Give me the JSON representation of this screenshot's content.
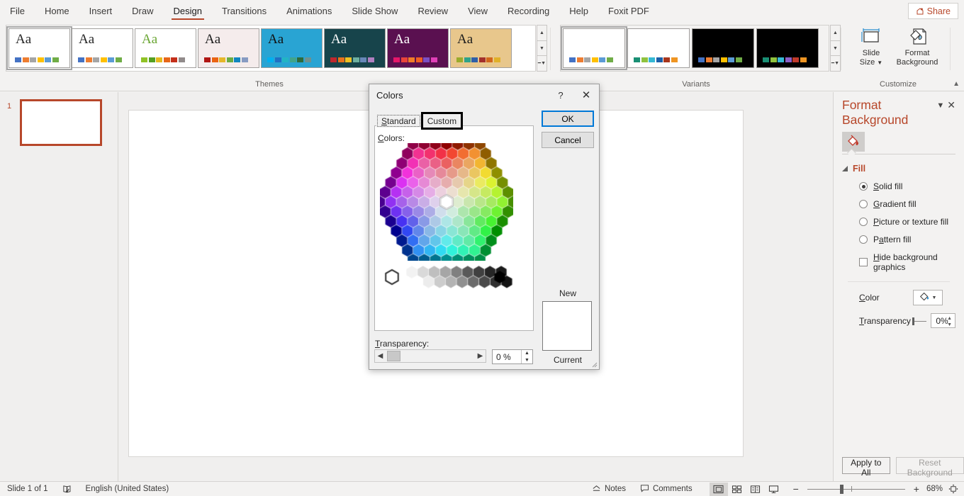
{
  "ribbon": {
    "tabs": [
      {
        "label": "File",
        "active": false
      },
      {
        "label": "Home",
        "active": false
      },
      {
        "label": "Insert",
        "active": false
      },
      {
        "label": "Draw",
        "active": false
      },
      {
        "label": "Design",
        "active": true
      },
      {
        "label": "Transitions",
        "active": false
      },
      {
        "label": "Animations",
        "active": false
      },
      {
        "label": "Slide Show",
        "active": false
      },
      {
        "label": "Review",
        "active": false
      },
      {
        "label": "View",
        "active": false
      },
      {
        "label": "Recording",
        "active": false
      },
      {
        "label": "Help",
        "active": false
      },
      {
        "label": "Foxit PDF",
        "active": false
      }
    ],
    "share_label": "Share",
    "share_icon": "share-person-icon",
    "collapse_icon": "chevron-up-icon",
    "groups": {
      "themes_label": "Themes",
      "variants_label": "Variants",
      "customize_label": "Customize"
    },
    "themes": [
      {
        "name": "office-theme",
        "sample": "Aa",
        "selected": true,
        "bg": "#ffffff",
        "aa_color": "#262626",
        "swatches": [
          "#4472c4",
          "#ed7d31",
          "#a5a5a5",
          "#ffc000",
          "#5b9bd5",
          "#70ad47"
        ]
      },
      {
        "name": "office-theme-2",
        "sample": "Aa",
        "selected": false,
        "bg": "#ffffff",
        "aa_color": "#262626",
        "swatches": [
          "#4472c4",
          "#ed7d31",
          "#a5a5a5",
          "#ffc000",
          "#5b9bd5",
          "#70ad47"
        ]
      },
      {
        "name": "facet-theme",
        "sample": "Aa",
        "selected": false,
        "bg": "#ffffff",
        "aa_color": "#6aa633",
        "swatches": [
          "#90c226",
          "#54a021",
          "#e6b91e",
          "#e76618",
          "#c42f1a",
          "#918b8b"
        ]
      },
      {
        "name": "badge-theme",
        "sample": "Aa",
        "selected": false,
        "bg": "#f5ecec",
        "aa_color": "#1c1c1c",
        "swatches": [
          "#b01513",
          "#ea6312",
          "#e6b729",
          "#6bac43",
          "#1086bf",
          "#879bc2"
        ]
      },
      {
        "name": "ion-boardroom-theme",
        "sample": "Aa",
        "selected": false,
        "bg": "#29a4d3",
        "aa_color": "#111111",
        "swatches": [
          "#00b0f0",
          "#1f6fc4",
          "#22b4c4",
          "#40a48a",
          "#2e6b3b",
          "#6d9191"
        ]
      },
      {
        "name": "wisp-theme",
        "sample": "Aa",
        "selected": false,
        "bg": "#17444b",
        "aa_color": "#ffffff",
        "swatches": [
          "#c0272d",
          "#e8711a",
          "#f0c020",
          "#6eb0a0",
          "#6888b8",
          "#b07fc0"
        ]
      },
      {
        "name": "berlin-theme",
        "sample": "Aa",
        "selected": false,
        "bg": "#5a1050",
        "aa_color": "#ffffff",
        "swatches": [
          "#e5176a",
          "#e8443a",
          "#ef7d28",
          "#ee5f22",
          "#7b4fc4",
          "#e040b8"
        ]
      },
      {
        "name": "wood-type-theme",
        "sample": "Aa",
        "selected": false,
        "bg": "#e8c78c",
        "aa_color": "#1c1c1c",
        "swatches": [
          "#9aab2c",
          "#2fa38a",
          "#2f5fa8",
          "#a3302c",
          "#d1661c",
          "#e0b029"
        ]
      }
    ],
    "variants": [
      {
        "name": "variant-1",
        "selected": true,
        "bg": "#ffffff",
        "swatches": [
          "#4472c4",
          "#ed7d31",
          "#a5a5a5",
          "#ffc000",
          "#5b9bd5",
          "#70ad47"
        ]
      },
      {
        "name": "variant-2",
        "selected": false,
        "bg": "#ffffff",
        "swatches": [
          "#1a8f74",
          "#8fc23e",
          "#35b8d4",
          "#1b5fa8",
          "#a8361c",
          "#ef9522"
        ]
      },
      {
        "name": "variant-3",
        "selected": false,
        "bg": "#000000",
        "swatches": [
          "#4472c4",
          "#ed7d31",
          "#a5a5a5",
          "#ffc000",
          "#5b9bd5",
          "#70ad47"
        ]
      },
      {
        "name": "variant-4",
        "selected": false,
        "bg": "#000000",
        "swatches": [
          "#1a8f74",
          "#8fc23e",
          "#35b8d4",
          "#8b5fc8",
          "#c0392b",
          "#ef9522"
        ]
      }
    ],
    "slide_size_label_1": "Slide",
    "slide_size_label_2": "Size",
    "format_background_label_1": "Format",
    "format_background_label_2": "Background",
    "scroll_up_icon": "chevron-up-icon",
    "scroll_down_icon": "chevron-down-icon",
    "scroll_more_icon": "more-gallery-icon"
  },
  "slides": {
    "items": [
      {
        "number": "1",
        "selected": true
      }
    ]
  },
  "format_pane": {
    "title": "Format Background",
    "menu_icon": "chevron-down-icon",
    "close_icon": "close-icon",
    "fill_tab_icon": "fill-bucket-icon",
    "fill_section": "Fill",
    "options": [
      {
        "label": "Solid fill",
        "accel": "S",
        "selected": true
      },
      {
        "label": "Gradient fill",
        "accel": "G",
        "selected": false
      },
      {
        "label": "Picture or texture fill",
        "accel": "P",
        "selected": false
      },
      {
        "label": "Pattern fill",
        "accel": "a",
        "selected": false
      }
    ],
    "hide_graphics": {
      "label": "Hide background graphics",
      "accel": "H",
      "checked": false
    },
    "color_label": "Color",
    "color_icon": "fill-bucket-icon",
    "color_dropdown_icon": "chevron-down-icon",
    "transparency_label": "Transparency",
    "transparency_value": "0%",
    "apply_to_all": "Apply to All",
    "reset_background": "Reset Background"
  },
  "dialog": {
    "title": "Colors",
    "help_icon": "question-mark-icon",
    "close_icon": "close-icon",
    "tabs": [
      {
        "label": "Standard",
        "active": false
      },
      {
        "label": "Custom",
        "active": true
      }
    ],
    "colors_label": "Colors:",
    "transparency_label": "Transparency:",
    "transparency_value": "0 %",
    "left_arrow_icon": "chevron-left-icon",
    "right_arrow_icon": "chevron-right-icon",
    "spin_up_icon": "spin-up-icon",
    "spin_down_icon": "spin-down-icon",
    "ok_label": "OK",
    "cancel_label": "Cancel",
    "new_label": "New",
    "current_label": "Current",
    "new_color": "#ffffff",
    "current_color": "#ffffff",
    "grip_icon": "resize-grip-icon",
    "selected_hex_outline": "#ffffff"
  },
  "status": {
    "slide_counter": "Slide 1 of 1",
    "spellcheck_icon": "spellcheck-icon",
    "language": "English (United States)",
    "notes_label": "Notes",
    "notes_icon": "notes-icon",
    "comments_label": "Comments",
    "comments_icon": "comment-bubble-icon",
    "views": [
      {
        "name": "normal-view",
        "icon": "normal-view-icon",
        "active": true
      },
      {
        "name": "slide-sorter-view",
        "icon": "slide-sorter-icon",
        "active": false
      },
      {
        "name": "reading-view",
        "icon": "reading-view-icon",
        "active": false
      },
      {
        "name": "slide-show-view",
        "icon": "slideshow-icon",
        "active": false
      }
    ],
    "zoom_out_icon": "minus-icon",
    "zoom_in_icon": "plus-icon",
    "zoom_value": "68%",
    "fit_icon": "fit-slide-icon"
  }
}
